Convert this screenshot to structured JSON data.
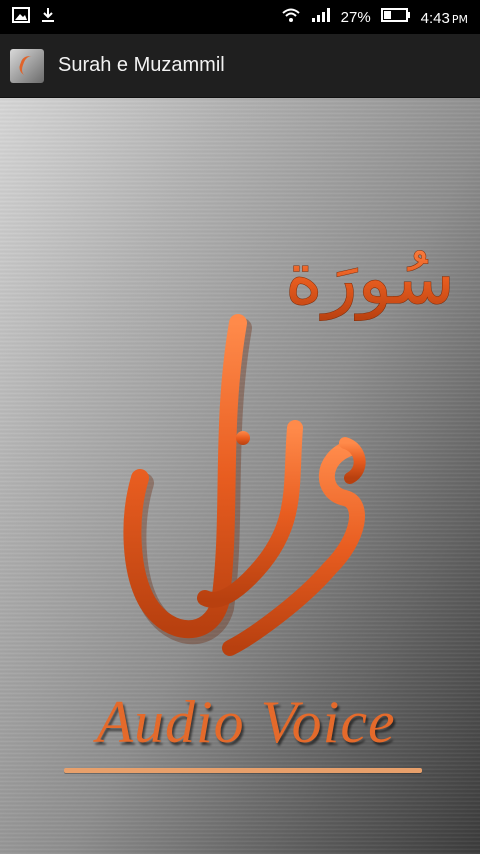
{
  "status_bar": {
    "battery_percent": "27%",
    "time": "4:43",
    "ampm": "PM",
    "icons": [
      "image-icon",
      "download-icon",
      "wifi-icon",
      "signal-icon",
      "battery-icon"
    ]
  },
  "app_bar": {
    "title": "Surah e Muzammil",
    "icon": "app-logo-icon"
  },
  "artwork": {
    "arabic_surah": "سُورَة",
    "arabic_name": "مزمل",
    "english_caption": "Audio Voice",
    "accent_color": "#e46a2b"
  }
}
